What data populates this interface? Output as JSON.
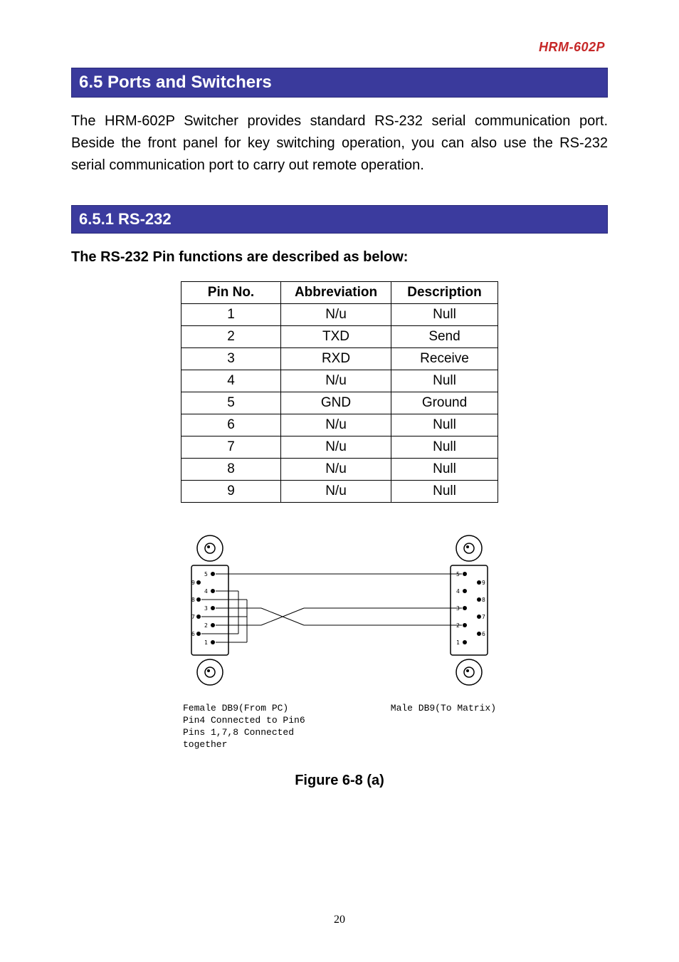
{
  "header": {
    "model": "HRM-602P"
  },
  "section": {
    "title": "6.5 Ports and Switchers"
  },
  "intro_paragraph": "The HRM-602P Switcher provides standard RS-232 serial communication port. Beside the front panel for key switching operation, you can also use the RS-232 serial communication port to carry out remote operation.",
  "subsection": {
    "title": "6.5.1 RS-232"
  },
  "table_intro": "The RS-232 Pin functions are described as below:",
  "table": {
    "headers": [
      "Pin No.",
      "Abbreviation",
      "Description"
    ],
    "rows": [
      [
        "1",
        "N/u",
        "Null"
      ],
      [
        "2",
        "TXD",
        "Send"
      ],
      [
        "3",
        "RXD",
        "Receive"
      ],
      [
        "4",
        "N/u",
        "Null"
      ],
      [
        "5",
        "GND",
        "Ground"
      ],
      [
        "6",
        "N/u",
        "Null"
      ],
      [
        "7",
        "N/u",
        "Null"
      ],
      [
        "8",
        "N/u",
        "Null"
      ],
      [
        "9",
        "N/u",
        "Null"
      ]
    ]
  },
  "diagram": {
    "female_caption_line1": "Female DB9(From PC)",
    "female_caption_line2": "Pin4 Connected to Pin6",
    "female_caption_line3": "Pins 1,7,8 Connected together",
    "male_caption": "Male DB9(To Matrix)",
    "female_pins": [
      "1",
      "2",
      "3",
      "4",
      "5",
      "6",
      "7",
      "8",
      "9"
    ],
    "male_pins": [
      "1",
      "2",
      "3",
      "4",
      "5",
      "6",
      "7",
      "8",
      "9"
    ]
  },
  "figure_label": "Figure 6-8 (a)",
  "page_number": "20"
}
